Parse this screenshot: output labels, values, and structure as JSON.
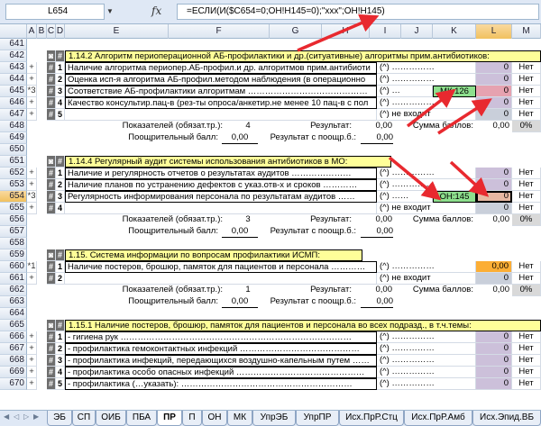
{
  "formula_bar": {
    "cell_ref": "L654",
    "fx": "fx",
    "formula": "=ЕСЛИ(И($C654=0;ОН!H145=0);\"ххх\";ОН!H145)"
  },
  "col_headers": [
    "A",
    "B",
    "C",
    "D",
    "E",
    "F",
    "G",
    "H",
    "I",
    "J",
    "K",
    "L",
    "M"
  ],
  "rows": {
    "r641": {
      "n": "641"
    },
    "r642": {
      "n": "642",
      "t": "1.14.2  Алгоритм периоперационной АБ-профилактики и др.(ситуативные) алгоритмы прим.антибиотиков:"
    },
    "r643": {
      "n": "643",
      "a": "+",
      "d": "1",
      "t": "Наличие алгоритма периопер.АБ-профил.и др. алгоритмов прим.антибиоти",
      "x": "(^) ……………",
      "l": "0",
      "m": "Нет"
    },
    "r644": {
      "n": "644",
      "a": "+",
      "d": "2",
      "t": "Оценка исп-я алгоритма АБ-профил.методом наблюдения (в операционно",
      "x": "(^) ……………",
      "l": "0",
      "m": "Нет"
    },
    "r645": {
      "n": "645",
      "a": "*3",
      "d": "3",
      "t": "Соответствие АБ-профилактики алгоритмам ……………………………………",
      "x": "(^) …",
      "k": "МК:126",
      "l": "0",
      "m": "Нет"
    },
    "r646": {
      "n": "646",
      "a": "+",
      "d": "4",
      "t": "Качество консультир.пац-в (рез-ты опроса/анкетир.не менее 10 пац-в с пол",
      "x": "(^) ……………",
      "l": "0",
      "m": "Нет"
    },
    "r647": {
      "n": "647",
      "a": "+",
      "d": "5",
      "t": "",
      "x": "(^) не входит",
      "l": "0",
      "m": "Нет"
    },
    "r648": {
      "n": "648",
      "t1": "Показателей (обязат.тр.):",
      "v1": "4",
      "t2": "Результат:",
      "v2": "0,00",
      "t3": "Сумма баллов:",
      "v3": "0,00",
      "pct": "0%"
    },
    "r649": {
      "n": "649",
      "t1": "Поощрительный балл:",
      "v1": "0,00",
      "t2": "Результат с поощр.б.:",
      "v2": "0,00"
    },
    "r650": {
      "n": "650"
    },
    "r651": {
      "n": "651",
      "t": "1.14.4  Регулярный аудит системы использования антибиотиков в МО:"
    },
    "r652": {
      "n": "652",
      "a": "+",
      "d": "1",
      "t": "Наличие и регулярность отчетов о результатах аудитов …………………",
      "x": "(^) ……………",
      "l": "0",
      "m": "Нет"
    },
    "r653": {
      "n": "653",
      "a": "+",
      "d": "2",
      "t": "Наличие планов по устранению дефектов с указ.отв-х и сроков …………",
      "x": "(^) ……………",
      "l": "0",
      "m": "Нет"
    },
    "r654": {
      "n": "654",
      "a": "*3",
      "d": "3",
      "t": "Регулярность информирования персонала по результатам аудитов ……",
      "x": "(^) ……",
      "k": "ОН:145",
      "l": "0",
      "m": "Нет"
    },
    "r655": {
      "n": "655",
      "a": "+",
      "d": "4",
      "t": "",
      "x": "(^) не входит",
      "l": "0",
      "m": "Нет"
    },
    "r656": {
      "n": "656",
      "t1": "Показателей (обязат.тр.):",
      "v1": "3",
      "t2": "Результат:",
      "v2": "0,00",
      "t3": "Сумма баллов:",
      "v3": "0,00",
      "pct": "0%"
    },
    "r657": {
      "n": "657",
      "t1": "Поощрительный балл:",
      "v1": "0,00",
      "t2": "Результат с поощр.б.:",
      "v2": "0,00"
    },
    "r658": {
      "n": "658"
    },
    "r659": {
      "n": "659",
      "t": "1.15.  Система информации по вопросам профилактики ИСМП:"
    },
    "r660": {
      "n": "660",
      "a": "*1",
      "d": "1",
      "t": "Наличие постеров, брошюр, памяток для пациентов и персонала …………",
      "x": "(^) ……………",
      "l": "0,00",
      "m": "Нет"
    },
    "r661": {
      "n": "661",
      "a": "+",
      "d": "2",
      "t": "",
      "x": "(^) не входит",
      "l": "0",
      "m": "Нет"
    },
    "r662": {
      "n": "662",
      "t1": "Показателей (обязат.тр.):",
      "v1": "1",
      "t2": "Результат:",
      "v2": "0,00",
      "t3": "Сумма баллов:",
      "v3": "0,00",
      "pct": "0%"
    },
    "r663": {
      "n": "663",
      "t1": "Поощрительный балл:",
      "v1": "0,00",
      "t2": "Результат с поощр.б.:",
      "v2": "0,00"
    },
    "r664": {
      "n": "664"
    },
    "r665": {
      "n": "665",
      "t": "1.15.1  Наличие постеров, брошюр, памяток для пациентов и персонала во всех подразд., в т.ч.темы:"
    },
    "r666": {
      "n": "666",
      "a": "+",
      "d": "1",
      "t": "- гигиена рук ………………………………………………………………………",
      "x": "(^) ……………",
      "l": "0",
      "m": "Нет"
    },
    "r667": {
      "n": "667",
      "a": "+",
      "d": "2",
      "t": "- профилактика гемоконтактных инфекций ……………………………………",
      "x": "(^) ……………",
      "l": "0",
      "m": "Нет"
    },
    "r668": {
      "n": "668",
      "a": "+",
      "d": "3",
      "t": "- профилактика инфекций, передающихся воздушно-капельным путем ……",
      "x": "(^) ……………",
      "l": "0",
      "m": "Нет"
    },
    "r669": {
      "n": "669",
      "a": "+",
      "d": "4",
      "t": "- профилактика особо опасных инфекций ………………………………………",
      "x": "(^) ……………",
      "l": "0",
      "m": "Нет"
    },
    "r670": {
      "n": "670",
      "a": "+",
      "d": "5",
      "t": "- профилактика (…указать): ……………………………………………………",
      "x": "(^) ……………",
      "l": "0",
      "m": "Нет"
    }
  },
  "sheet_tabs": [
    "ЭБ",
    "СП",
    "ОИБ",
    "ПБА",
    "ПР",
    "П",
    "ОН",
    "МК",
    "УпрЭБ",
    "УпрПР",
    "Исх.ПрР.Стц",
    "Исх.ПрР.Амб",
    "Исх.Эпид.ВБ"
  ],
  "active_tab": "ПР",
  "colors": {
    "arrow": "#e8292f",
    "green": "#8ddf8d",
    "pink": "#e6a2b0",
    "orange": "#fcae35",
    "violet": "#ccc0da",
    "section": "#ffff99"
  }
}
